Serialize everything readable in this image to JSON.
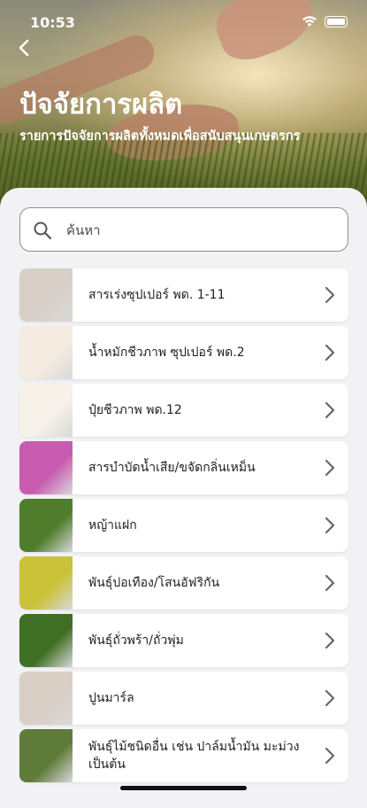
{
  "status_bar": {
    "time": "10:53"
  },
  "header": {
    "title": "ปัจจัยการผลิต",
    "subtitle": "รายการปัจจัยการผลิตทั้งหมดเพื่อสนับสนุนเกษตรกร"
  },
  "search": {
    "placeholder": "ค้นหา"
  },
  "items": [
    {
      "label": "สารเร่งซุปเปอร์ พด. 1-11",
      "thumb_color": "#d8d0c8"
    },
    {
      "label": "น้ำหมักชีวภาพ ซุปเปอร์ พด.2",
      "thumb_color": "#f4ece0"
    },
    {
      "label": "ปุ๋ยชีวภาพ พด.12",
      "thumb_color": "#f6f2ea"
    },
    {
      "label": "สารบำบัดน้ำเสีย/ขจัดกลิ่นเหม็น",
      "thumb_color": "#c85bb0"
    },
    {
      "label": "หญ้าแฝก",
      "thumb_color": "#4f7d2c"
    },
    {
      "label": "พันธุ์ปอเทือง/โสนอัฟริกัน",
      "thumb_color": "#c9c23a"
    },
    {
      "label": "พันธุ์ถั่วพร้า/ถั่วพุ่ม",
      "thumb_color": "#3f6f25"
    },
    {
      "label": "ปูนมาร์ล",
      "thumb_color": "#d9cfc4"
    },
    {
      "label": "พันธุ์ไม้ชนิดอื่น เช่น ปาล์มน้ำมัน มะม่วง เป็นต้น",
      "thumb_color": "#5f7b3a"
    }
  ]
}
